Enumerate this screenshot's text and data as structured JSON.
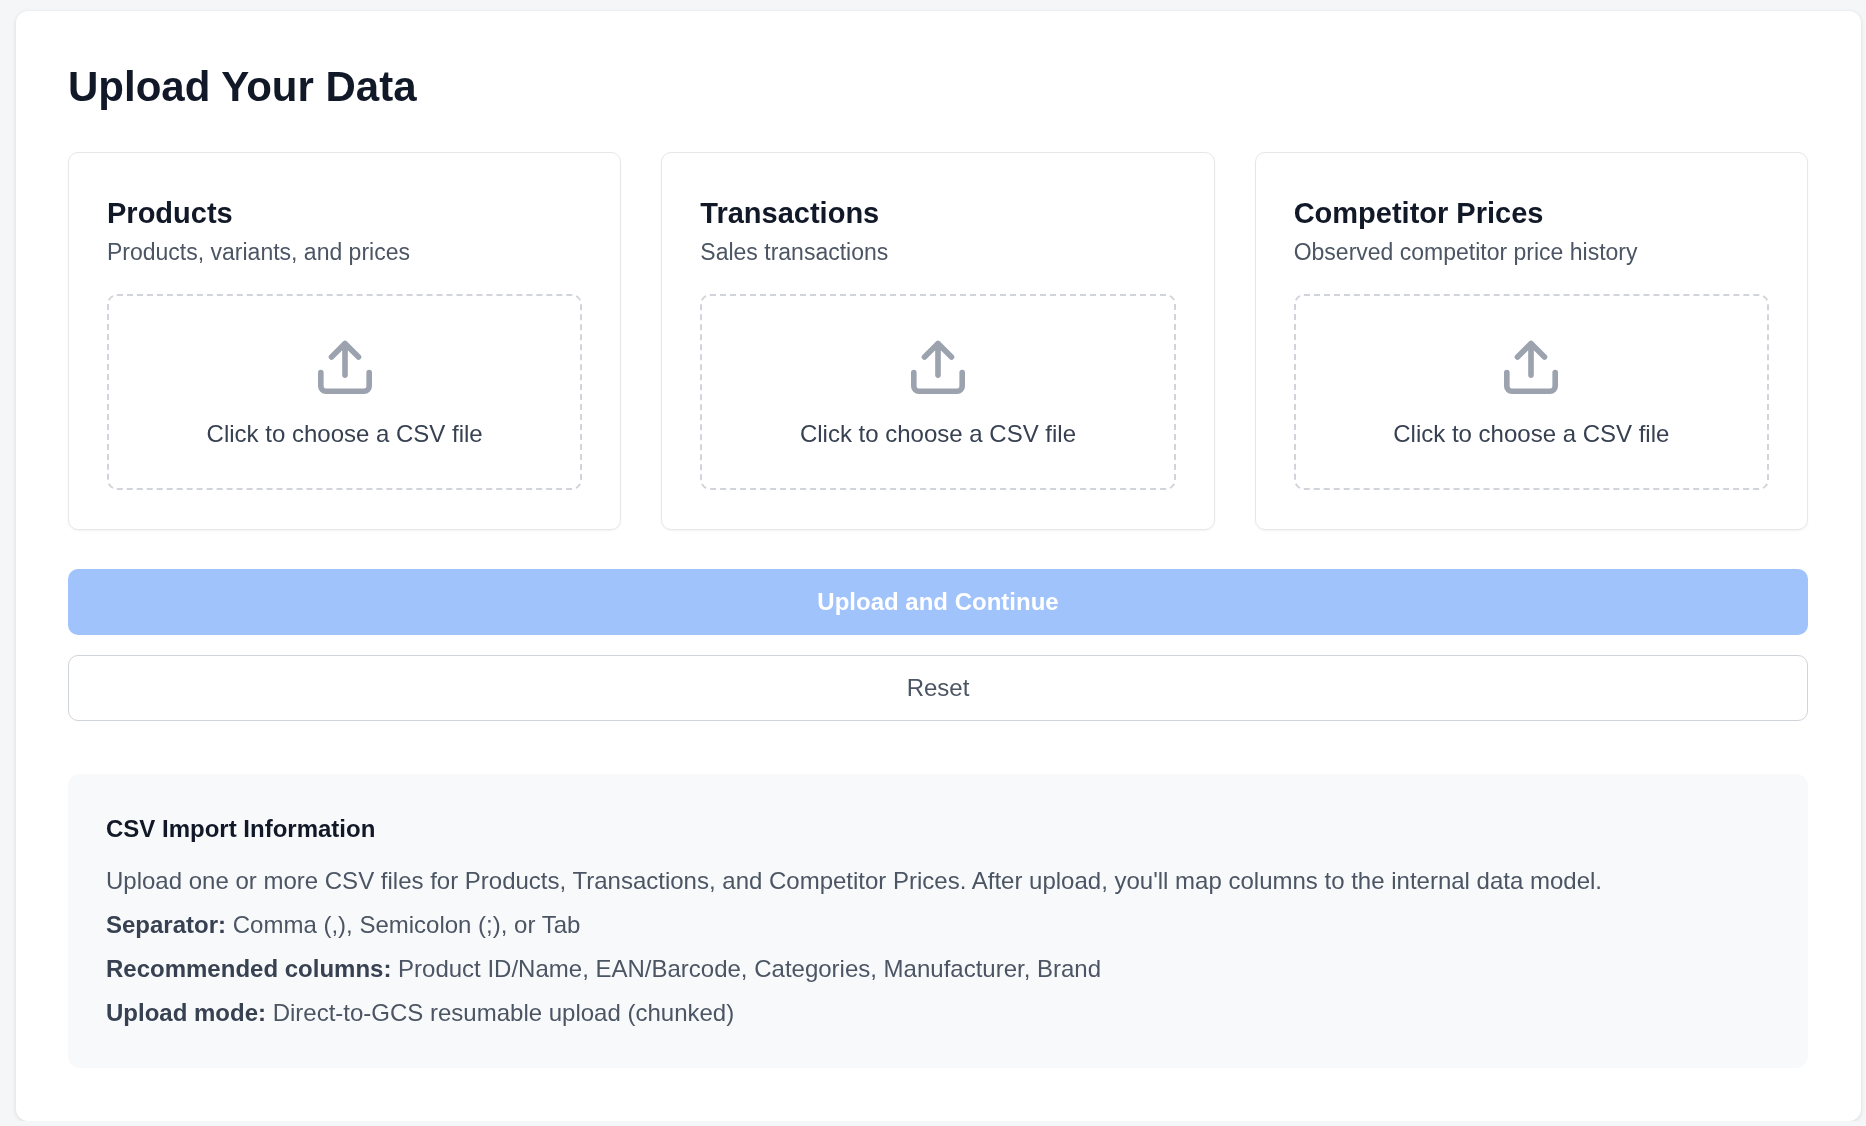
{
  "page": {
    "title": "Upload Your Data"
  },
  "upload_cards": [
    {
      "title": "Products",
      "description": "Products, variants, and prices",
      "dropzone_label": "Click to choose a CSV file"
    },
    {
      "title": "Transactions",
      "description": "Sales transactions",
      "dropzone_label": "Click to choose a CSV file"
    },
    {
      "title": "Competitor Prices",
      "description": "Observed competitor price history",
      "dropzone_label": "Click to choose a CSV file"
    }
  ],
  "primary_button": {
    "label": "Upload and Continue",
    "disabled": true
  },
  "secondary_button": {
    "label": "Reset"
  },
  "info_panel": {
    "title": "CSV Import Information",
    "lines": [
      "Upload one or more CSV files for Products, Transactions, and Competitor Prices. After upload, you'll map columns to the internal data model.",
      "**Separator:** Comma (,), Semicolon (;), or Tab",
      "**Recommended columns:** Product ID/Name, EAN/Barcode, Categories, Manufacturer, Brand",
      "**Upload mode:** Direct-to-GCS resumable upload (chunked)"
    ]
  }
}
